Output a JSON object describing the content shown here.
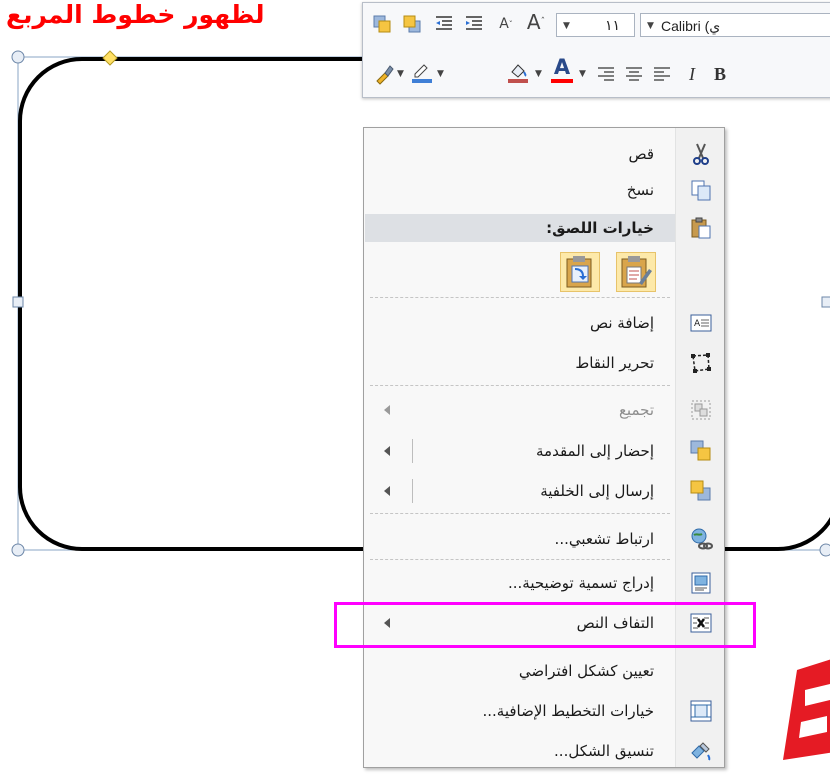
{
  "caption": "لظهور خطوط المربع",
  "mini_toolbar": {
    "font_name": "Calibri (ي",
    "font_size": "١١"
  },
  "menu": {
    "cut": "قص",
    "copy": "نسخ",
    "paste_options": "خيارات اللصق:",
    "add_text": "إضافة نص",
    "edit_points": "تحرير النقاط",
    "group": "تجميع",
    "bring_to_front": "إحضار إلى المقدمة",
    "send_to_back": "إرسال إلى الخلفية",
    "hyperlink": "ارتباط تشعبي...",
    "insert_caption": "إدراج تسمية توضيحية...",
    "wrap_text": "التفاف النص",
    "set_default_shape": "تعيين كشكل افتراضي",
    "more_layout": "خيارات التخطيط الإضافية...",
    "format_shape": "تنسيق الشكل..."
  },
  "colors": {
    "caption": "#ff0000",
    "highlight": "#ff00ff",
    "menu_bg": "#f8f8f8",
    "font_color_bar": "#ff0000",
    "highlight_color_bar": "#3f7fd6",
    "fill_color_bar": "#c0504d"
  },
  "icons": {
    "cut": "scissors-icon",
    "copy": "copy-icon",
    "paste": "clipboard-icon",
    "add_text": "text-box-icon",
    "edit_points": "edit-points-icon",
    "group": "group-icon",
    "bring_to_front": "bring-front-icon",
    "send_to_back": "send-back-icon",
    "hyperlink": "globe-link-icon",
    "insert_caption": "caption-icon",
    "wrap_text": "wrap-text-icon",
    "more_layout": "layout-options-icon",
    "format_shape": "format-shape-icon"
  }
}
